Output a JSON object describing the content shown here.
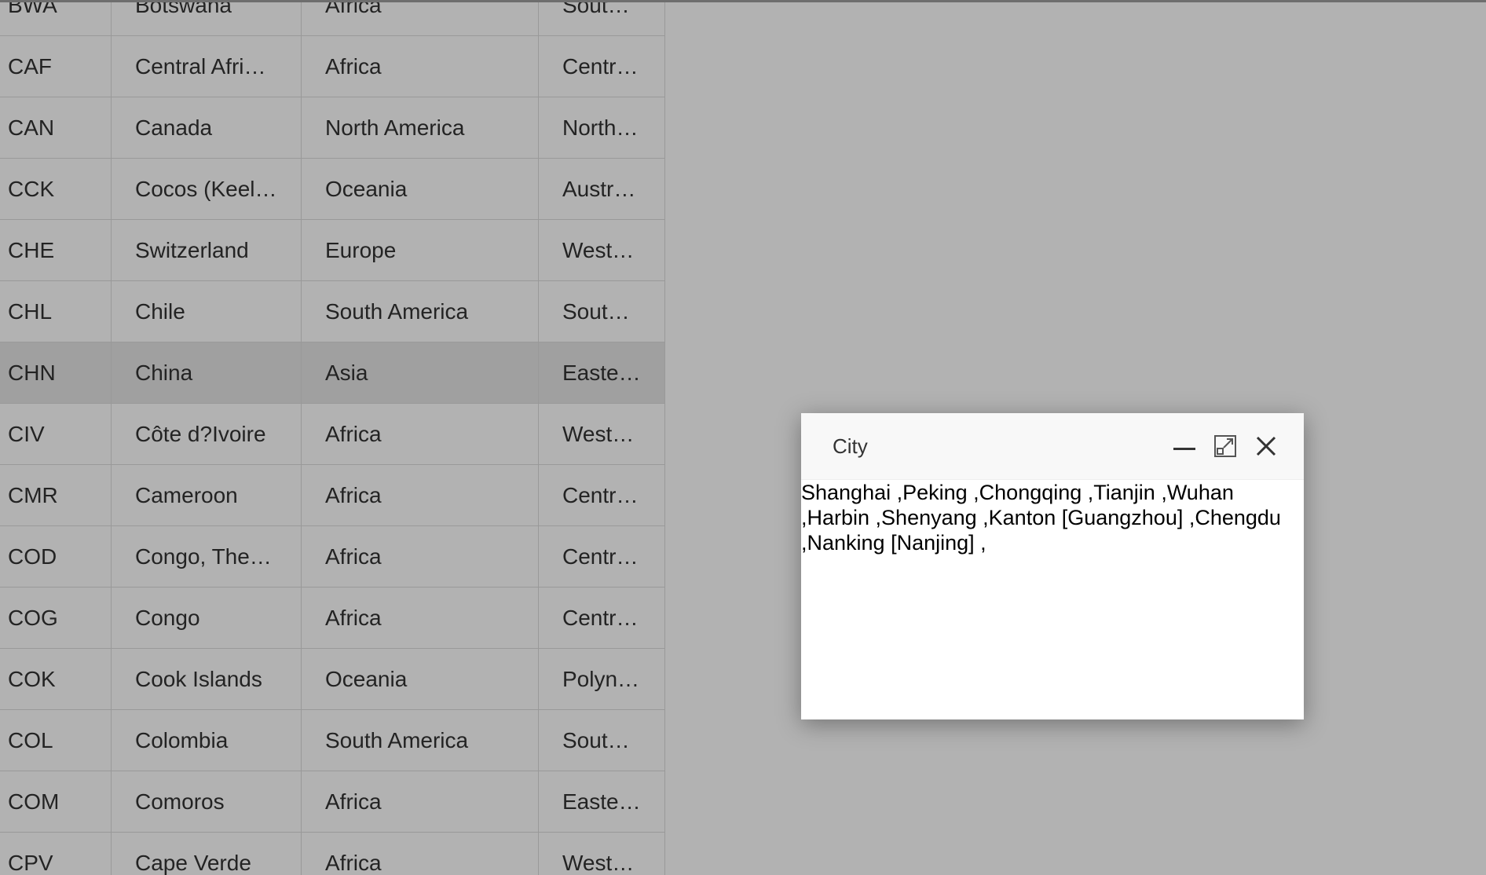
{
  "grid": {
    "rows": [
      {
        "code": "BWA",
        "name": "Botswana",
        "continent": "Africa",
        "region": "Sout…"
      },
      {
        "code": "CAF",
        "name": "Central Afri…",
        "continent": "Africa",
        "region": "Centr…"
      },
      {
        "code": "CAN",
        "name": "Canada",
        "continent": "North America",
        "region": "North…"
      },
      {
        "code": "CCK",
        "name": "Cocos (Keel…",
        "continent": "Oceania",
        "region": "Austr…"
      },
      {
        "code": "CHE",
        "name": "Switzerland",
        "continent": "Europe",
        "region": "West…"
      },
      {
        "code": "CHL",
        "name": "Chile",
        "continent": "South America",
        "region": "Sout…"
      },
      {
        "code": "CHN",
        "name": "China",
        "continent": "Asia",
        "region": "Easte…"
      },
      {
        "code": "CIV",
        "name": "Côte d?Ivoire",
        "continent": "Africa",
        "region": "West…"
      },
      {
        "code": "CMR",
        "name": "Cameroon",
        "continent": "Africa",
        "region": "Centr…"
      },
      {
        "code": "COD",
        "name": "Congo, The…",
        "continent": "Africa",
        "region": "Centr…"
      },
      {
        "code": "COG",
        "name": "Congo",
        "continent": "Africa",
        "region": "Centr…"
      },
      {
        "code": "COK",
        "name": "Cook Islands",
        "continent": "Oceania",
        "region": "Polyn…"
      },
      {
        "code": "COL",
        "name": "Colombia",
        "continent": "South America",
        "region": "Sout…"
      },
      {
        "code": "COM",
        "name": "Comoros",
        "continent": "Africa",
        "region": "Easte…"
      },
      {
        "code": "CPV",
        "name": "Cape Verde",
        "continent": "Africa",
        "region": "West…"
      }
    ],
    "selected_code": "CHN"
  },
  "dialog": {
    "title": "City",
    "content": "Shanghai ,Peking ,Chongqing ,Tianjin ,Wuhan ,Harbin ,Shenyang ,Kanton [Guangzhou] ,Chengdu ,Nanking [Nanjing] ,",
    "icons": {
      "minimize": "minimize-icon",
      "maximize": "maximize-icon",
      "close": "close-icon"
    }
  }
}
